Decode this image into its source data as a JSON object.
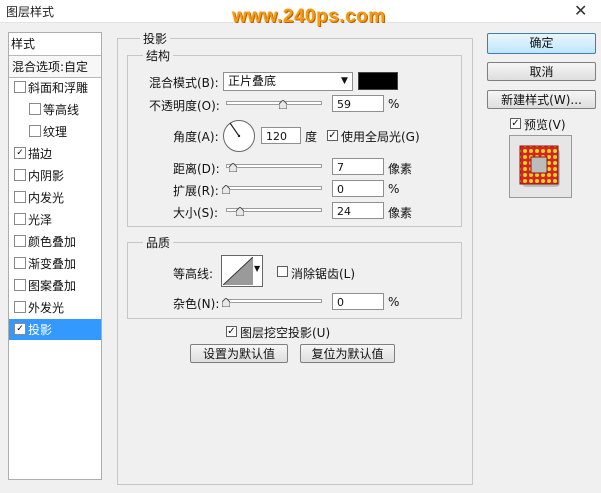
{
  "window": {
    "title": "图层样式",
    "close_glyph": "✕"
  },
  "watermark": "www.240ps.com",
  "styles_panel": {
    "header": "样式",
    "blend_options": "混合选项:自定",
    "items": [
      {
        "label": "斜面和浮雕",
        "checked": false,
        "indent": false
      },
      {
        "label": "等高线",
        "checked": false,
        "indent": true
      },
      {
        "label": "纹理",
        "checked": false,
        "indent": true
      },
      {
        "label": "描边",
        "checked": true,
        "indent": false
      },
      {
        "label": "内阴影",
        "checked": false,
        "indent": false
      },
      {
        "label": "内发光",
        "checked": false,
        "indent": false
      },
      {
        "label": "光泽",
        "checked": false,
        "indent": false
      },
      {
        "label": "颜色叠加",
        "checked": false,
        "indent": false
      },
      {
        "label": "渐变叠加",
        "checked": false,
        "indent": false
      },
      {
        "label": "图案叠加",
        "checked": false,
        "indent": false
      },
      {
        "label": "外发光",
        "checked": false,
        "indent": false
      },
      {
        "label": "投影",
        "checked": true,
        "indent": false,
        "selected": true
      }
    ]
  },
  "shadow": {
    "section_title": "投影",
    "structure": {
      "title": "结构",
      "blend_mode_label": "混合模式(B):",
      "blend_mode_value": "正片叠底",
      "color": "#000000",
      "opacity_label": "不透明度(O):",
      "opacity_value": "59",
      "opacity_unit": "%",
      "angle_label": "角度(A):",
      "angle_value": "120",
      "angle_unit": "度",
      "global_light_label": "使用全局光(G)",
      "global_light_checked": true,
      "distance_label": "距离(D):",
      "distance_value": "7",
      "distance_unit": "像素",
      "spread_label": "扩展(R):",
      "spread_value": "0",
      "spread_unit": "%",
      "size_label": "大小(S):",
      "size_value": "24",
      "size_unit": "像素"
    },
    "quality": {
      "title": "品质",
      "contour_label": "等高线:",
      "antialias_label": "消除锯齿(L)",
      "antialias_checked": false,
      "noise_label": "杂色(N):",
      "noise_value": "0",
      "noise_unit": "%"
    },
    "knockout_label": "图层挖空投影(U)",
    "knockout_checked": true,
    "set_default": "设置为默认值",
    "reset_default": "复位为默认值"
  },
  "buttons": {
    "ok": "确定",
    "cancel": "取消",
    "new_style": "新建样式(W)...",
    "preview_label": "预览(V)",
    "preview_checked": true
  },
  "icons": {
    "dropdown": "triangle-down-icon",
    "checkmark": "checkmark-icon",
    "angle": "angle-dial-icon",
    "contour": "contour-curve-icon"
  }
}
